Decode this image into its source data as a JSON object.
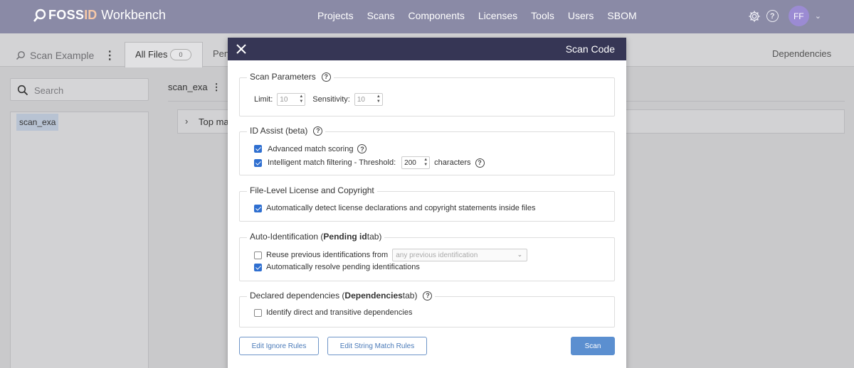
{
  "nav": {
    "logo_part1": "FOSS",
    "logo_part2": "ID",
    "logo_part3": "Workbench",
    "links": [
      "Projects",
      "Scans",
      "Components",
      "Licenses",
      "Tools",
      "Users",
      "SBOM"
    ],
    "avatar_initials": "FF"
  },
  "page": {
    "scan_name": "Scan Example",
    "tab_all_files": "All Files",
    "tab_all_files_count": "0",
    "tab_pending_partial": "Pen",
    "tab_dependencies": "Dependencies",
    "search_placeholder": "Search",
    "tree_root": "scan_exa",
    "breadcrumb": "scan_exa",
    "top_match_partial": "Top ma"
  },
  "modal": {
    "title": "Scan Code",
    "scan_parameters": {
      "legend": "Scan Parameters",
      "limit_label": "Limit:",
      "limit_value": "10",
      "sensitivity_label": "Sensitivity:",
      "sensitivity_value": "10"
    },
    "id_assist": {
      "legend": "ID Assist (beta)",
      "advanced_label": "Advanced match scoring",
      "advanced_checked": true,
      "intelligent_label": "Intelligent match filtering - Threshold:",
      "intelligent_checked": true,
      "threshold_value": "200",
      "threshold_unit": "characters"
    },
    "file_level": {
      "legend": "File-Level License and Copyright",
      "detect_label": "Automatically detect license declarations and copyright statements inside files",
      "detect_checked": true
    },
    "auto_id": {
      "legend_pre": "Auto-Identification (",
      "legend_bold": "Pending id",
      "legend_post": " tab)",
      "reuse_label": "Reuse previous identifications from",
      "reuse_checked": false,
      "reuse_select": "any previous identification",
      "resolve_label": "Automatically resolve pending identifications",
      "resolve_checked": true
    },
    "declared_deps": {
      "legend_pre": "Declared dependencies (",
      "legend_bold": "Dependencies",
      "legend_post": " tab)",
      "identify_label": "Identify direct and transitive dependencies",
      "identify_checked": false
    },
    "buttons": {
      "ignore_rules": "Edit Ignore Rules",
      "string_rules": "Edit String Match Rules",
      "scan": "Scan"
    }
  }
}
